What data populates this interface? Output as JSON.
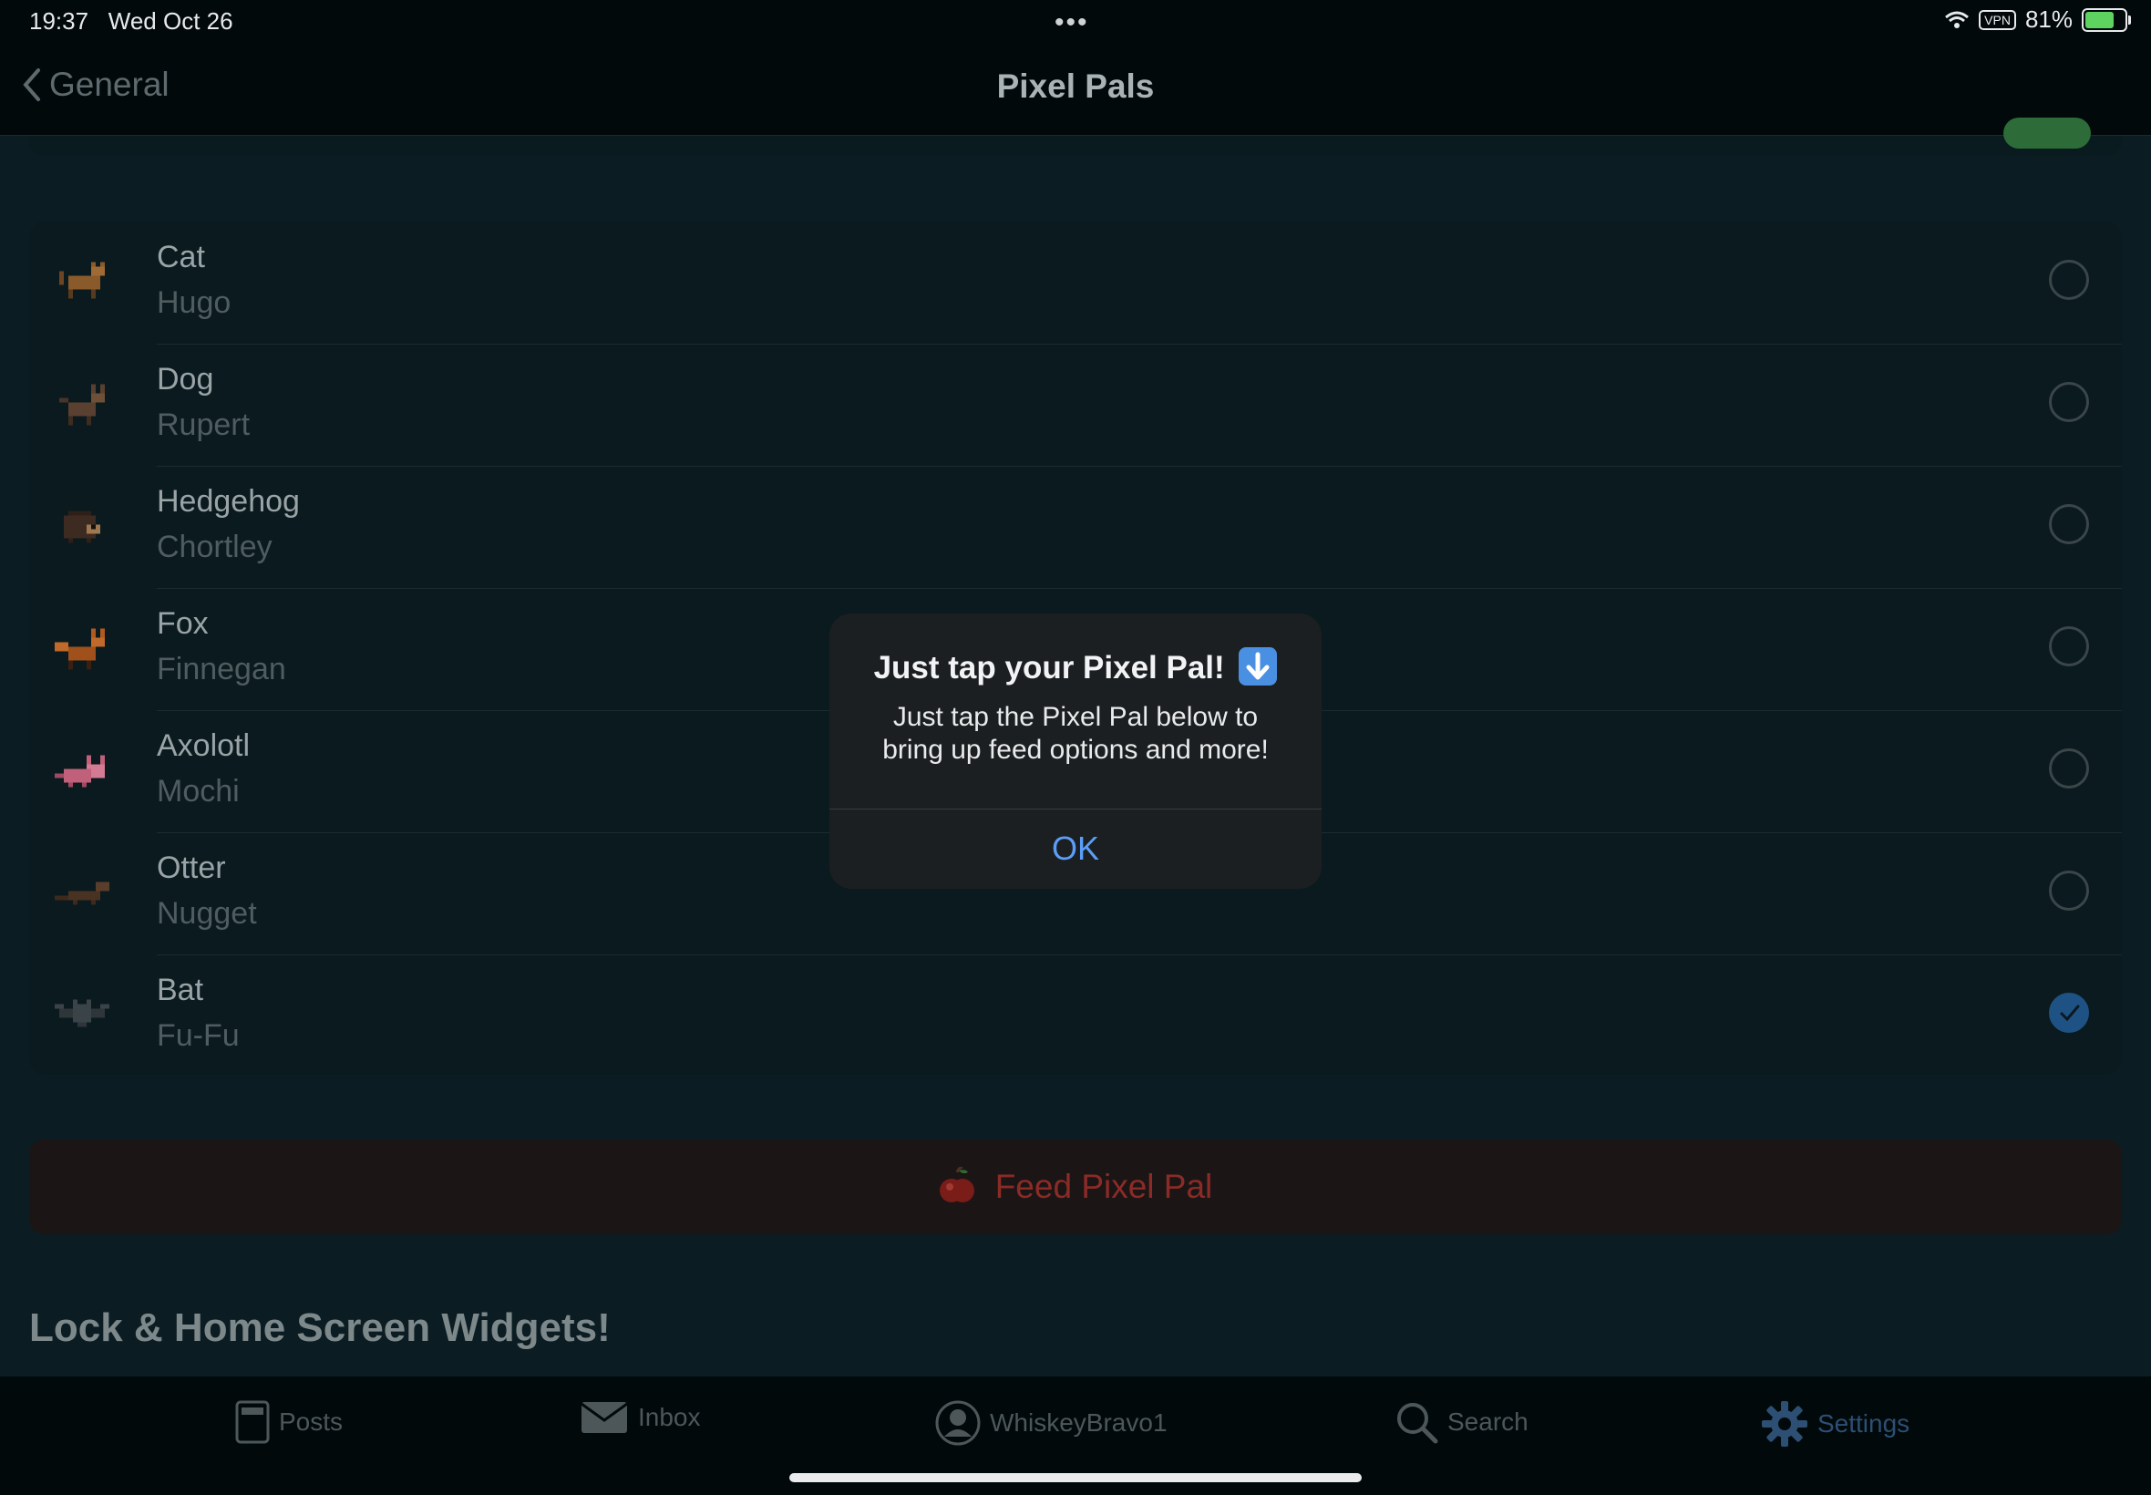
{
  "status_bar": {
    "time": "19:37",
    "date": "Wed Oct 26",
    "vpn": "VPN",
    "battery": "81%",
    "battery_level": 0.81
  },
  "nav": {
    "back_label": "General",
    "title": "Pixel Pals"
  },
  "pals": [
    {
      "type": "Cat",
      "name": "Hugo",
      "selected": false
    },
    {
      "type": "Dog",
      "name": "Rupert",
      "selected": false
    },
    {
      "type": "Hedgehog",
      "name": "Chortley",
      "selected": false
    },
    {
      "type": "Fox",
      "name": "Finnegan",
      "selected": false
    },
    {
      "type": "Axolotl",
      "name": "Mochi",
      "selected": false
    },
    {
      "type": "Otter",
      "name": "Nugget",
      "selected": false
    },
    {
      "type": "Bat",
      "name": "Fu-Fu",
      "selected": true
    }
  ],
  "feed_button": {
    "label": "Feed Pixel Pal",
    "icon": "apple-icon"
  },
  "section_title": "Lock & Home Screen Widgets!",
  "alert": {
    "title": "Just tap your Pixel Pal!",
    "title_icon": "down-arrow-emoji-icon",
    "message": "Just tap the Pixel Pal below to bring up feed options and more!",
    "ok_label": "OK"
  },
  "tabs": [
    {
      "label": "Posts",
      "icon": "posts-icon"
    },
    {
      "label": "Inbox",
      "icon": "envelope-icon"
    },
    {
      "label": "WhiskeyBravo1",
      "icon": "profile-icon"
    },
    {
      "label": "Search",
      "icon": "search-icon"
    },
    {
      "label": "Settings",
      "icon": "gear-icon",
      "active": true
    }
  ],
  "colors": {
    "accent": "#5a9ef8",
    "feed": "#8b2b26",
    "selected": "#1f5284",
    "toggle_on": "#2d6b39"
  }
}
